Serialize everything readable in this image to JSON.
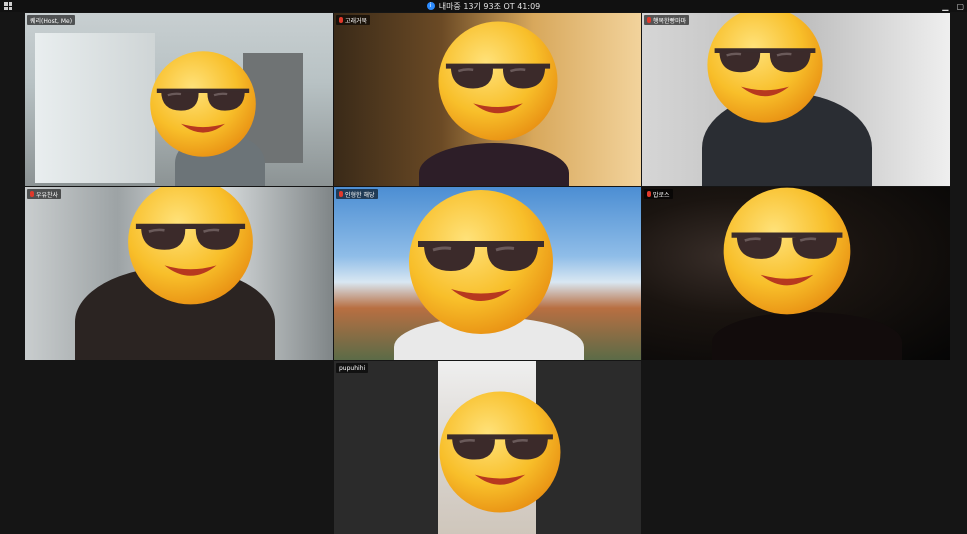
{
  "window": {
    "meeting_status": "내마중 13기 93조 OT 41:09",
    "info_icon": "i"
  },
  "participants": [
    {
      "name": "퀘리(Host, Me)",
      "muted": false
    },
    {
      "name": "고래거북",
      "muted": true
    },
    {
      "name": "행복한빵마마",
      "muted": true
    },
    {
      "name": "우유찬사",
      "muted": true
    },
    {
      "name": "인형한 해당",
      "muted": true
    },
    {
      "name": "밥로스",
      "muted": true
    },
    {
      "name": "pupuhihi",
      "muted": false
    }
  ],
  "colors": {
    "mic_muted": "#e0392b",
    "info_accent": "#2d8cff",
    "emoji_face": "#f6b21a"
  },
  "icons": {
    "face_cover": "smiling-face-with-sunglasses"
  }
}
